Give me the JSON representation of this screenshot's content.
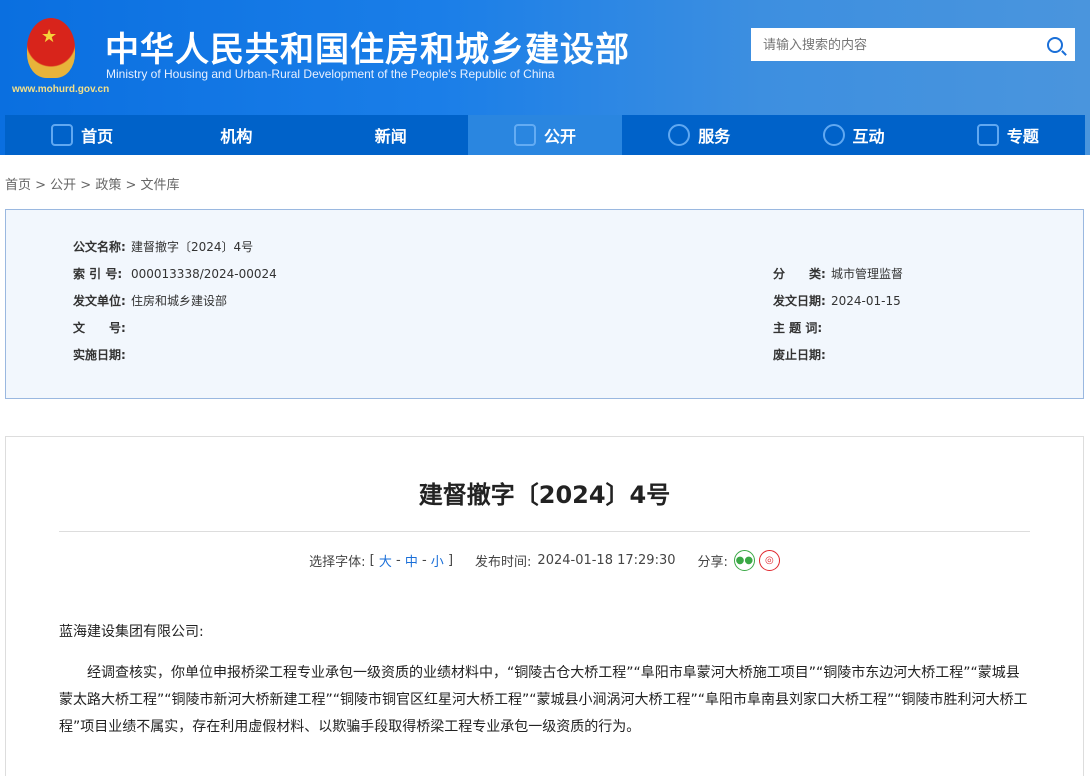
{
  "header": {
    "title_cn": "中华人民共和国住房和城乡建设部",
    "title_en": "Ministry of Housing and Urban-Rural Development of the People's Republic of China",
    "url": "www.mohurd.gov.cn",
    "search_placeholder": "请输入搜索的内容"
  },
  "nav": [
    {
      "label": "首页",
      "icon": "home-icon"
    },
    {
      "label": "机构"
    },
    {
      "label": "新闻"
    },
    {
      "label": "公开",
      "icon": "document-icon",
      "active": true
    },
    {
      "label": "服务",
      "icon": "service-icon"
    },
    {
      "label": "互动",
      "icon": "interact-icon"
    },
    {
      "label": "专题",
      "icon": "star-icon"
    }
  ],
  "breadcrumb": "首页 > 公开 > 政策 > 文件库",
  "meta": {
    "name_label": "公文名称:",
    "name": "建督撤字〔2024〕4号",
    "index_label": "索 引 号:",
    "index": "000013338/2024-00024",
    "category_label": "分　　类:",
    "category": "城市管理监督",
    "issuer_label": "发文单位:",
    "issuer": "住房和城乡建设部",
    "date_label": "发文日期:",
    "date": "2024-01-15",
    "docno_label": "文　　号:",
    "docno": "",
    "keywords_label": "主 题 词:",
    "keywords": "",
    "effective_label": "实施日期:",
    "effective": "",
    "expire_label": "废止日期:",
    "expire": ""
  },
  "article": {
    "title": "建督撤字〔2024〕4号",
    "font_label": "选择字体:",
    "font_large": "大",
    "font_mid": "中",
    "font_small": "小",
    "publish_label": "发布时间:",
    "publish_time": "2024-01-18 17:29:30",
    "share_label": "分享:",
    "greeting": "蓝海建设集团有限公司:",
    "paragraph": "经调查核实，你单位申报桥梁工程专业承包一级资质的业绩材料中，“铜陵古仓大桥工程”“阜阳市阜蒙河大桥施工项目”“铜陵市东边河大桥工程”“蒙城县蒙太路大桥工程”“铜陵市新河大桥新建工程”“铜陵市铜官区红星河大桥工程”“蒙城县小涧涡河大桥工程”“阜阳市阜南县刘家口大桥工程”“铜陵市胜利河大桥工程”项目业绩不属实，存在利用虚假材料、以欺骗手段取得桥梁工程专业承包一级资质的行为。"
  }
}
